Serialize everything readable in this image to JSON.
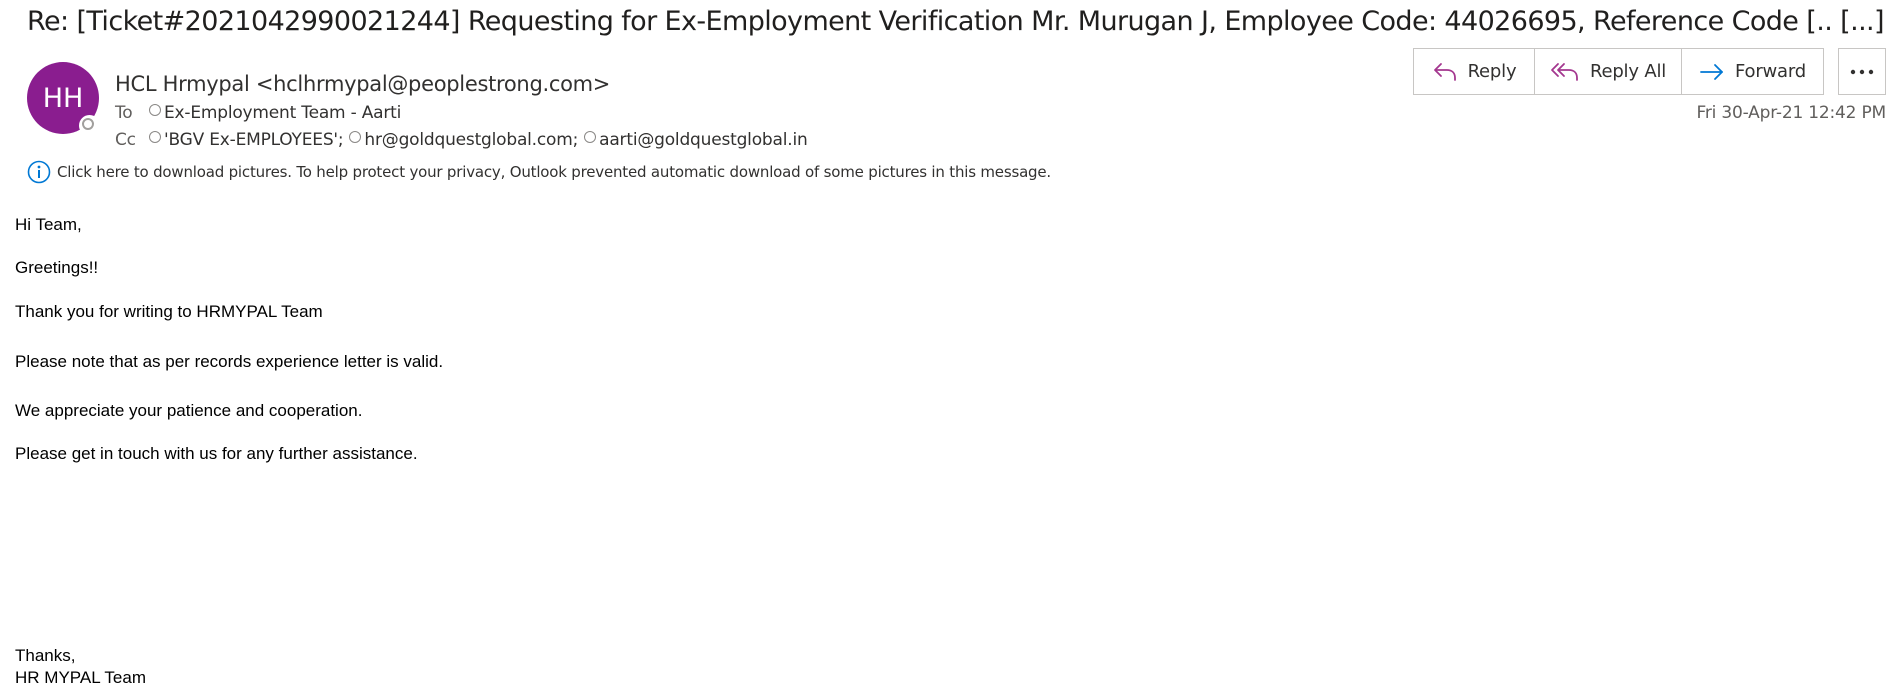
{
  "subject": "Re: [Ticket#2021042990021244] Requesting for Ex-Employment Verification Mr. Murugan J, Employee Code: 44026695, Reference Code [.. [...]",
  "avatar": {
    "initials": "HH",
    "color": "#8a1d8f"
  },
  "sender": "HCL Hrmypal <hclhrmypal@peoplestrong.com>",
  "to": {
    "label": "To",
    "recipients": [
      "Ex-Employment Team - Aarti"
    ]
  },
  "cc": {
    "label": "Cc",
    "recipients": [
      "'BGV Ex-EMPLOYEES';",
      "hr@goldquestglobal.com;",
      "aarti@goldquestglobal.in"
    ]
  },
  "date": "Fri 30-Apr-21 12:42 PM",
  "info_bar": {
    "icon": "info-icon",
    "text": "Click here to download pictures. To help protect your privacy, Outlook prevented automatic download of some pictures in this message."
  },
  "actions": {
    "reply": "Reply",
    "reply_all": "Reply All",
    "forward": "Forward",
    "more_icon": "more-icon"
  },
  "body": {
    "lines": [
      "Hi Team,",
      "Greetings!!",
      "Thank you for writing to HRMYPAL Team",
      "Please note that as per records experience letter is valid.",
      "We appreciate your patience and cooperation.",
      "Please get in touch with us for any further assistance.",
      "Thanks,",
      "HR MYPAL Team"
    ]
  },
  "colors": {
    "accent_purple": "#8a1d8f",
    "reply_icon": "#a4378f",
    "forward_icon": "#0078d4",
    "info_icon": "#0078d4"
  }
}
